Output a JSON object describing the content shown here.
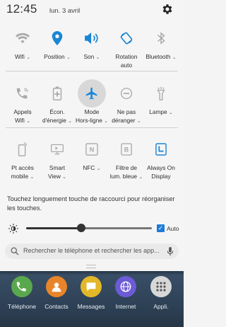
{
  "status": {
    "time": "12:45",
    "date": "lun. 3 avril"
  },
  "tiles": [
    {
      "name": "wifi",
      "label": "Wifi",
      "arrow": true,
      "icon": "wifi-icon"
    },
    {
      "name": "position",
      "label": "Position",
      "arrow": true,
      "icon": "location-pin-icon"
    },
    {
      "name": "son",
      "label": "Son",
      "arrow": true,
      "icon": "speaker-icon"
    },
    {
      "name": "rotation",
      "label": "Rotation\nauto",
      "arrow": false,
      "icon": "rotation-icon"
    },
    {
      "name": "bluetooth",
      "label": "Bluetooth",
      "arrow": true,
      "icon": "bluetooth-icon"
    },
    {
      "name": "appels-wifi",
      "label": "Appels\nWifi",
      "arrow": true,
      "icon": "wifi-calling-icon"
    },
    {
      "name": "econ-energie",
      "label": "Écon.\nd'énergie",
      "arrow": true,
      "icon": "battery-saver-icon"
    },
    {
      "name": "mode-hors-ligne",
      "label": "Mode\nHors-ligne",
      "arrow": true,
      "icon": "airplane-icon"
    },
    {
      "name": "ne-pas-deranger",
      "label": "Ne pas\ndéranger",
      "arrow": true,
      "icon": "do-not-disturb-icon"
    },
    {
      "name": "lampe",
      "label": "Lampe",
      "arrow": true,
      "icon": "flashlight-icon"
    },
    {
      "name": "pt-acces-mobile",
      "label": "Pt accès\nmobile",
      "arrow": true,
      "icon": "hotspot-icon"
    },
    {
      "name": "smart-view",
      "label": "Smart\nView",
      "arrow": true,
      "icon": "smart-view-icon"
    },
    {
      "name": "nfc",
      "label": "NFC",
      "arrow": true,
      "icon": "nfc-icon"
    },
    {
      "name": "filtre-lum-bleue",
      "label": "Filtre de\nlum. bleue",
      "arrow": true,
      "icon": "blue-light-filter-icon"
    },
    {
      "name": "always-on-display",
      "label": "Always On\nDisplay",
      "arrow": false,
      "icon": "always-on-display-icon"
    }
  ],
  "hint": "Touchez longuement touche de raccourci pour réorganiser les touches.",
  "brightness": {
    "level": 0.44,
    "auto_label": "Auto",
    "auto_checked": true
  },
  "search": {
    "placeholder": "Rechercher le téléphone et rechercher les app..."
  },
  "dock": [
    {
      "label": "Téléphone",
      "color": "#5aa84e",
      "icon": "phone-icon"
    },
    {
      "label": "Contacts",
      "color": "#e8852a",
      "icon": "contacts-icon"
    },
    {
      "label": "Messages",
      "color": "#e3b72a",
      "icon": "messages-icon"
    },
    {
      "label": "Internet",
      "color": "#6c5bd6",
      "icon": "internet-icon"
    },
    {
      "label": "Appli.",
      "color": "#d8d8d8",
      "icon": "apps-grid-icon"
    }
  ],
  "colors": {
    "active": "#1a86d6",
    "inactive": "#a9a9a9"
  }
}
